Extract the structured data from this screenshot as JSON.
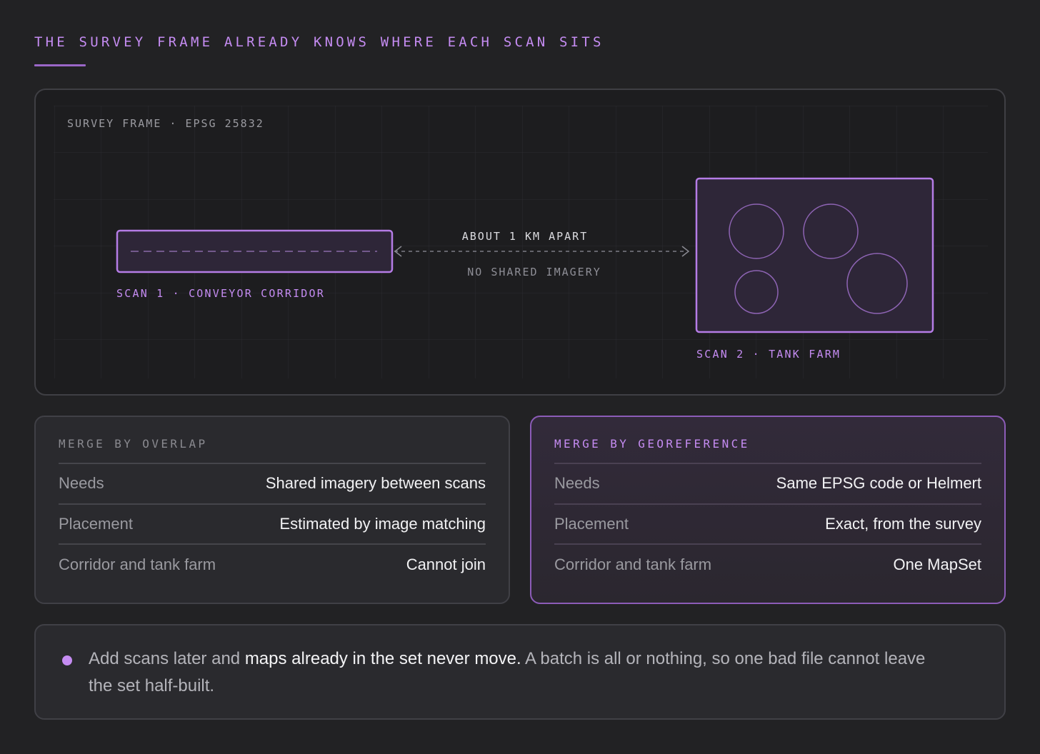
{
  "header": {
    "title": "THE SURVEY FRAME ALREADY KNOWS WHERE EACH SCAN SITS"
  },
  "diagram": {
    "frame_label": "SURVEY FRAME · EPSG 25832",
    "scan1_label": "SCAN 1 · CONVEYOR CORRIDOR",
    "scan2_label": "SCAN 2 · TANK FARM",
    "distance_label": "ABOUT 1 KM APART",
    "imagery_label": "NO SHARED IMAGERY"
  },
  "cards": {
    "overlap": {
      "title": "MERGE BY OVERLAP",
      "rows": [
        {
          "label": "Needs",
          "value": "Shared imagery between scans"
        },
        {
          "label": "Placement",
          "value": "Estimated by image matching"
        },
        {
          "label": "Corridor and tank farm",
          "value": "Cannot join"
        }
      ]
    },
    "georef": {
      "title": "MERGE BY GEOREFERENCE",
      "rows": [
        {
          "label": "Needs",
          "value": "Same EPSG code or Helmert"
        },
        {
          "label": "Placement",
          "value": "Exact, from the survey"
        },
        {
          "label": "Corridor and tank farm",
          "value": "One MapSet"
        }
      ]
    }
  },
  "note": {
    "part1": "Add scans later and ",
    "emphasis": "maps already in the set never move.",
    "part2": " A batch is all or nothing, so one bad file cannot leave the set half-built."
  },
  "colors": {
    "accent": "#c58cf2",
    "background": "#222224",
    "panel": "#1d1d1f"
  }
}
